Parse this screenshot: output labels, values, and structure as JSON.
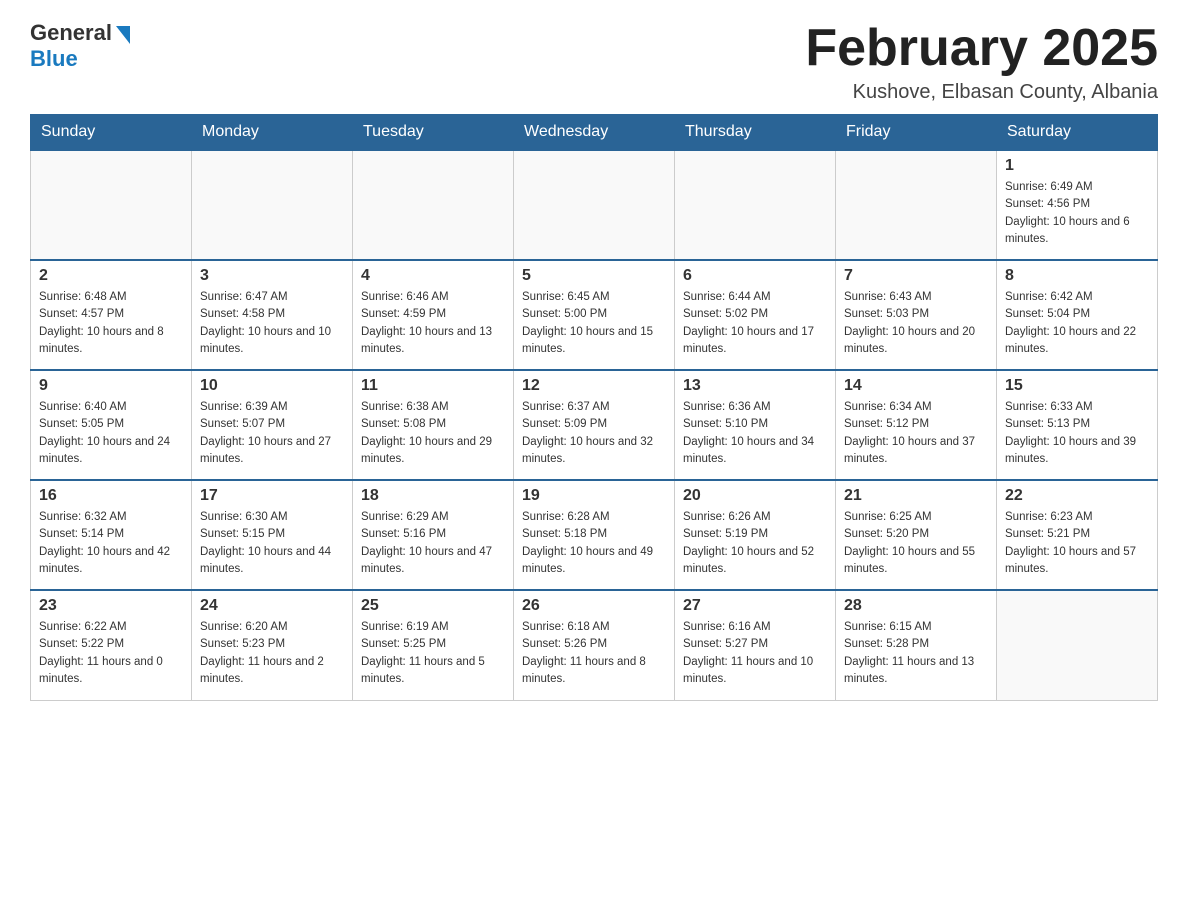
{
  "header": {
    "logo_text": "General",
    "logo_blue": "Blue",
    "title": "February 2025",
    "subtitle": "Kushove, Elbasan County, Albania"
  },
  "days_of_week": [
    "Sunday",
    "Monday",
    "Tuesday",
    "Wednesday",
    "Thursday",
    "Friday",
    "Saturday"
  ],
  "weeks": [
    [
      {
        "day": "",
        "info": ""
      },
      {
        "day": "",
        "info": ""
      },
      {
        "day": "",
        "info": ""
      },
      {
        "day": "",
        "info": ""
      },
      {
        "day": "",
        "info": ""
      },
      {
        "day": "",
        "info": ""
      },
      {
        "day": "1",
        "info": "Sunrise: 6:49 AM\nSunset: 4:56 PM\nDaylight: 10 hours and 6 minutes."
      }
    ],
    [
      {
        "day": "2",
        "info": "Sunrise: 6:48 AM\nSunset: 4:57 PM\nDaylight: 10 hours and 8 minutes."
      },
      {
        "day": "3",
        "info": "Sunrise: 6:47 AM\nSunset: 4:58 PM\nDaylight: 10 hours and 10 minutes."
      },
      {
        "day": "4",
        "info": "Sunrise: 6:46 AM\nSunset: 4:59 PM\nDaylight: 10 hours and 13 minutes."
      },
      {
        "day": "5",
        "info": "Sunrise: 6:45 AM\nSunset: 5:00 PM\nDaylight: 10 hours and 15 minutes."
      },
      {
        "day": "6",
        "info": "Sunrise: 6:44 AM\nSunset: 5:02 PM\nDaylight: 10 hours and 17 minutes."
      },
      {
        "day": "7",
        "info": "Sunrise: 6:43 AM\nSunset: 5:03 PM\nDaylight: 10 hours and 20 minutes."
      },
      {
        "day": "8",
        "info": "Sunrise: 6:42 AM\nSunset: 5:04 PM\nDaylight: 10 hours and 22 minutes."
      }
    ],
    [
      {
        "day": "9",
        "info": "Sunrise: 6:40 AM\nSunset: 5:05 PM\nDaylight: 10 hours and 24 minutes."
      },
      {
        "day": "10",
        "info": "Sunrise: 6:39 AM\nSunset: 5:07 PM\nDaylight: 10 hours and 27 minutes."
      },
      {
        "day": "11",
        "info": "Sunrise: 6:38 AM\nSunset: 5:08 PM\nDaylight: 10 hours and 29 minutes."
      },
      {
        "day": "12",
        "info": "Sunrise: 6:37 AM\nSunset: 5:09 PM\nDaylight: 10 hours and 32 minutes."
      },
      {
        "day": "13",
        "info": "Sunrise: 6:36 AM\nSunset: 5:10 PM\nDaylight: 10 hours and 34 minutes."
      },
      {
        "day": "14",
        "info": "Sunrise: 6:34 AM\nSunset: 5:12 PM\nDaylight: 10 hours and 37 minutes."
      },
      {
        "day": "15",
        "info": "Sunrise: 6:33 AM\nSunset: 5:13 PM\nDaylight: 10 hours and 39 minutes."
      }
    ],
    [
      {
        "day": "16",
        "info": "Sunrise: 6:32 AM\nSunset: 5:14 PM\nDaylight: 10 hours and 42 minutes."
      },
      {
        "day": "17",
        "info": "Sunrise: 6:30 AM\nSunset: 5:15 PM\nDaylight: 10 hours and 44 minutes."
      },
      {
        "day": "18",
        "info": "Sunrise: 6:29 AM\nSunset: 5:16 PM\nDaylight: 10 hours and 47 minutes."
      },
      {
        "day": "19",
        "info": "Sunrise: 6:28 AM\nSunset: 5:18 PM\nDaylight: 10 hours and 49 minutes."
      },
      {
        "day": "20",
        "info": "Sunrise: 6:26 AM\nSunset: 5:19 PM\nDaylight: 10 hours and 52 minutes."
      },
      {
        "day": "21",
        "info": "Sunrise: 6:25 AM\nSunset: 5:20 PM\nDaylight: 10 hours and 55 minutes."
      },
      {
        "day": "22",
        "info": "Sunrise: 6:23 AM\nSunset: 5:21 PM\nDaylight: 10 hours and 57 minutes."
      }
    ],
    [
      {
        "day": "23",
        "info": "Sunrise: 6:22 AM\nSunset: 5:22 PM\nDaylight: 11 hours and 0 minutes."
      },
      {
        "day": "24",
        "info": "Sunrise: 6:20 AM\nSunset: 5:23 PM\nDaylight: 11 hours and 2 minutes."
      },
      {
        "day": "25",
        "info": "Sunrise: 6:19 AM\nSunset: 5:25 PM\nDaylight: 11 hours and 5 minutes."
      },
      {
        "day": "26",
        "info": "Sunrise: 6:18 AM\nSunset: 5:26 PM\nDaylight: 11 hours and 8 minutes."
      },
      {
        "day": "27",
        "info": "Sunrise: 6:16 AM\nSunset: 5:27 PM\nDaylight: 11 hours and 10 minutes."
      },
      {
        "day": "28",
        "info": "Sunrise: 6:15 AM\nSunset: 5:28 PM\nDaylight: 11 hours and 13 minutes."
      },
      {
        "day": "",
        "info": ""
      }
    ]
  ]
}
